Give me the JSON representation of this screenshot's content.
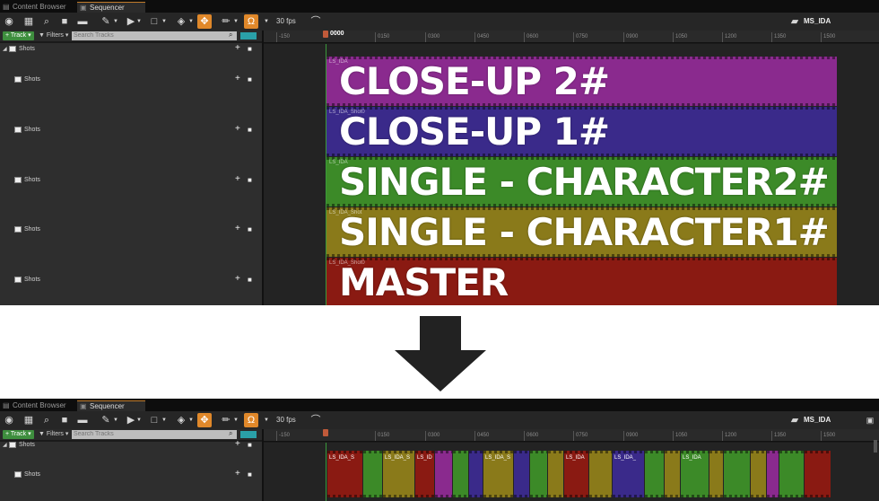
{
  "top": {
    "tabs": [
      {
        "label": "Content Browser",
        "icon": "folder-icon"
      },
      {
        "label": "Sequencer",
        "icon": "sequencer-icon"
      }
    ],
    "fps": "30 fps",
    "sequence_name": "MS_IDA",
    "track_button": "Track",
    "filters": "Filters",
    "search_placeholder": "Search Tracks",
    "playhead_frame": "0000",
    "ruler_ticks": [
      "-150",
      "0150",
      "0300",
      "0450",
      "0600",
      "0750",
      "0900",
      "1050",
      "1200",
      "1350",
      "1500"
    ],
    "tree": {
      "root": "Shots",
      "children": [
        "Shots",
        "Shots",
        "Shots",
        "Shots",
        "Shots"
      ]
    },
    "lanes": [
      {
        "overlay": "CLOSE-UP 2#",
        "small": "LS_IDA",
        "color": "#8a2a8e"
      },
      {
        "overlay": "CLOSE-UP 1#",
        "small": "LS_IDA_Shot0",
        "color": "#3a2a8a"
      },
      {
        "overlay": "SINGLE - CHARACTER2#",
        "small": "LS_IDA",
        "color": "#3c8a28"
      },
      {
        "overlay": "SINGLE - CHARACTER1#",
        "small": "LS_IDA_Shot",
        "color": "#8a7a1a"
      },
      {
        "overlay": "MASTER",
        "small": "LS_IDA_Shot0",
        "color": "#8a1a12"
      }
    ]
  },
  "bottom": {
    "tabs": [
      {
        "label": "Content Browser",
        "icon": "folder-icon"
      },
      {
        "label": "Sequencer",
        "icon": "sequencer-icon"
      }
    ],
    "fps": "30 fps",
    "sequence_name": "MS_IDA",
    "track_button": "Track",
    "filters": "Filters",
    "search_placeholder": "Search Tracks",
    "ruler_ticks": [
      "-150",
      "0150",
      "0300",
      "0450",
      "0600",
      "0750",
      "0900",
      "1050",
      "1200",
      "1350",
      "1500"
    ],
    "tree": {
      "root": "Shots",
      "children": [
        "Shots"
      ]
    },
    "clips": [
      {
        "label": "LS_IDA_S",
        "color": "#8a1a12"
      },
      {
        "label": "",
        "color": "#3c8a28"
      },
      {
        "label": "LS_IDA_S",
        "color": "#8a7a1a"
      },
      {
        "label": "LS_ID",
        "color": "#8a1a12"
      },
      {
        "label": "",
        "color": "#8a2a8e"
      },
      {
        "label": "",
        "color": "#3c8a28"
      },
      {
        "label": "",
        "color": "#3a2a8a"
      },
      {
        "label": "LS_IDA_S",
        "color": "#8a7a1a"
      },
      {
        "label": "",
        "color": "#3a2a8a"
      },
      {
        "label": "",
        "color": "#3c8a28"
      },
      {
        "label": "",
        "color": "#8a7a1a"
      },
      {
        "label": "LS_IDA",
        "color": "#8a1a12"
      },
      {
        "label": "",
        "color": "#8a7a1a"
      },
      {
        "label": "LS_IDA_",
        "color": "#3a2a8a"
      },
      {
        "label": "",
        "color": "#3c8a28"
      },
      {
        "label": "",
        "color": "#8a7a1a"
      },
      {
        "label": "LS_IDA",
        "color": "#3c8a28"
      },
      {
        "label": "",
        "color": "#8a7a1a"
      },
      {
        "label": "",
        "color": "#3c8a28"
      },
      {
        "label": "",
        "color": "#8a7a1a"
      },
      {
        "label": "",
        "color": "#8a2a8e"
      },
      {
        "label": "",
        "color": "#3c8a28"
      },
      {
        "label": "",
        "color": "#8a1a12"
      }
    ]
  }
}
